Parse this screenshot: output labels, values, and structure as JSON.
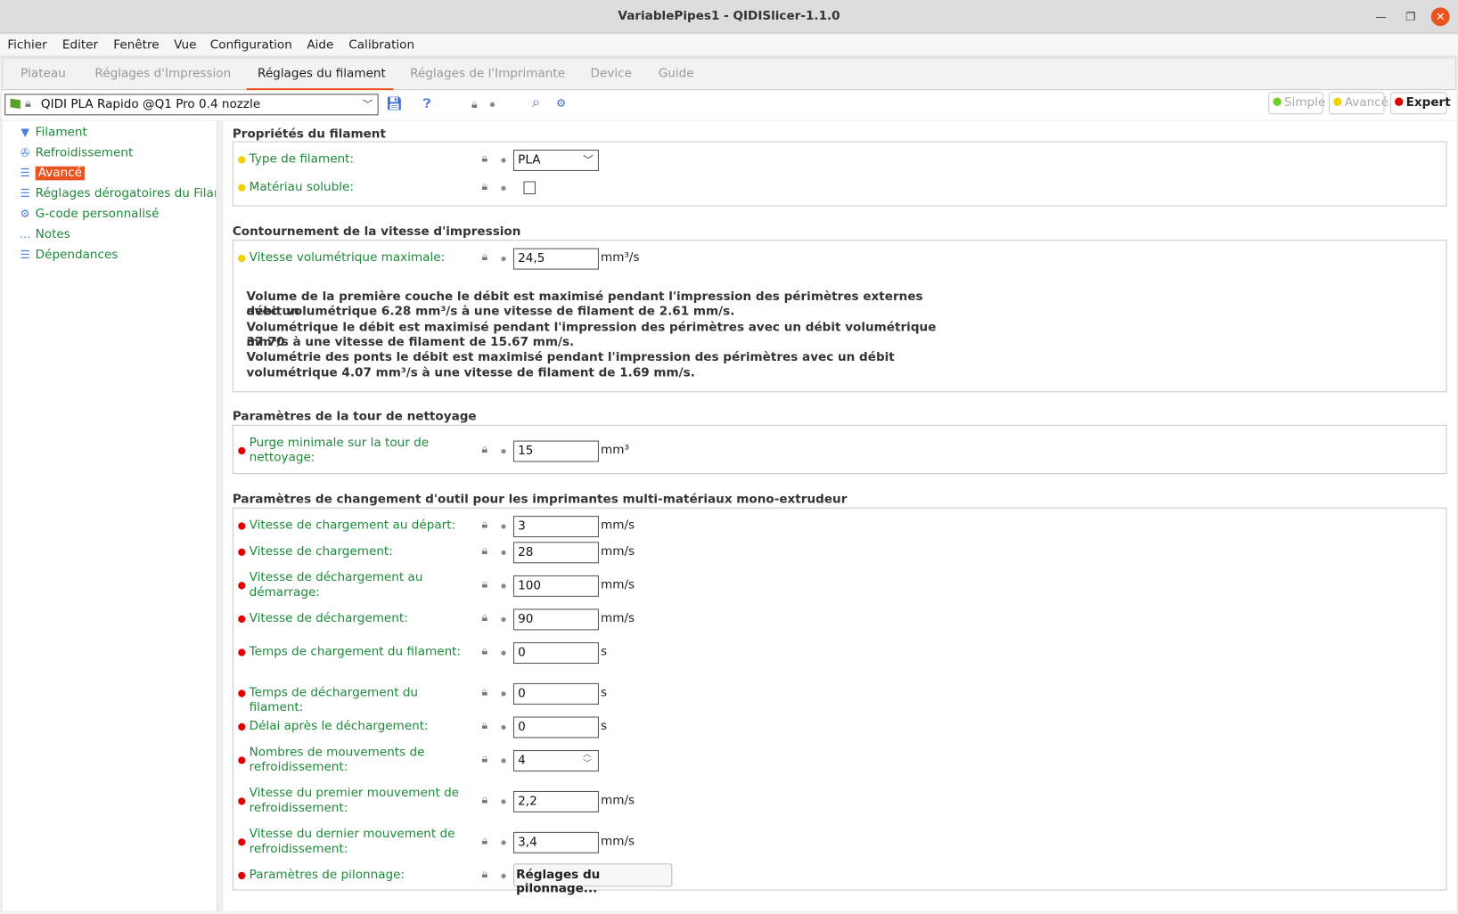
{
  "window": {
    "title": "VariablePipes1 - QIDISlicer-1.1.0"
  },
  "menu": [
    "Fichier",
    "Editer",
    "Fenêtre",
    "Vue",
    "Configuration",
    "Aide",
    "Calibration"
  ],
  "tabs": [
    "Plateau",
    "Réglages d'Impression",
    "Réglages du filament",
    "Réglages de l'Imprimante",
    "Device",
    "Guide"
  ],
  "active_tab": "Réglages du filament",
  "preset": {
    "name": "QIDI PLA Rapido @Q1 Pro 0.4 nozzle"
  },
  "modes": [
    {
      "label": "Simple",
      "color": "#6fd123"
    },
    {
      "label": "Avancé",
      "color": "#f0d000"
    },
    {
      "label": "Expert",
      "color": "#e00000"
    }
  ],
  "sidebar": [
    {
      "label": "Filament",
      "icon": "filament-icon"
    },
    {
      "label": "Refroidissement",
      "icon": "fan-icon"
    },
    {
      "label": "Avancé",
      "icon": "advanced-icon"
    },
    {
      "label": "Réglages dérogatoires du Filament",
      "icon": "overrides-icon"
    },
    {
      "label": "G-code personnalisé",
      "icon": "gear-icon"
    },
    {
      "label": "Notes",
      "icon": "notes-icon"
    },
    {
      "label": "Dépendances",
      "icon": "dependencies-icon"
    }
  ],
  "groups": [
    {
      "title": "Propriétés du filament"
    },
    {
      "title": "Contournement de la vitesse d'impression"
    },
    {
      "title": "Paramètres de la tour de nettoyage"
    },
    {
      "title": "Paramètres de changement d'outil pour les imprimantes multi-matériaux mono-extrudeur"
    }
  ],
  "colors": {
    "advanced": "#f0d000",
    "expert": "#e00000",
    "label": "#1d8a3a",
    "accent": "#e95420"
  },
  "rows": [
    {
      "label": "Type de filament:",
      "level": "advanced",
      "type": "select",
      "value": "PLA"
    },
    {
      "label": "Matériau soluble:",
      "level": "advanced",
      "type": "checkbox",
      "checked": false
    },
    {
      "label": "Vitesse volumétrique maximale:",
      "level": "advanced",
      "type": "input",
      "value": "24,5",
      "unit": "mm³/s"
    },
    {
      "label": "Purge minimale sur la tour de nettoyage:",
      "level": "expert",
      "type": "input",
      "value": "15",
      "unit": "mm³"
    },
    {
      "label": "Vitesse de chargement au départ:",
      "level": "expert",
      "type": "input",
      "value": "3",
      "unit": "mm/s"
    },
    {
      "label": "Vitesse de chargement:",
      "level": "expert",
      "type": "input",
      "value": "28",
      "unit": "mm/s"
    },
    {
      "label": "Vitesse de déchargement au démarrage:",
      "level": "expert",
      "type": "input",
      "value": "100",
      "unit": "mm/s"
    },
    {
      "label": "Vitesse de déchargement:",
      "level": "expert",
      "type": "input",
      "value": "90",
      "unit": "mm/s"
    },
    {
      "label": "Temps de chargement du filament:",
      "level": "expert",
      "type": "input",
      "value": "0",
      "unit": "s"
    },
    {
      "label": "Temps de déchargement du filament:",
      "level": "expert",
      "type": "input",
      "value": "0",
      "unit": "s"
    },
    {
      "label": "Délai après le déchargement:",
      "level": "expert",
      "type": "input",
      "value": "0",
      "unit": "s"
    },
    {
      "label": "Nombres de mouvements de refroidissement:",
      "level": "expert",
      "type": "spin",
      "value": "4"
    },
    {
      "label": "Vitesse du premier mouvement de refroidissement:",
      "level": "expert",
      "type": "input",
      "value": "2,2",
      "unit": "mm/s"
    },
    {
      "label": "Vitesse du dernier mouvement de refroidissement:",
      "level": "expert",
      "type": "input",
      "value": "3,4",
      "unit": "mm/s"
    },
    {
      "label": "Paramètres de pilonnage:",
      "level": "expert",
      "type": "button",
      "value": "Réglages du pilonnage..."
    }
  ],
  "info_lines": [
    "Volume de la première couche le débit est maximisé pendant l'impression des périmètres externes avec un",
    "débit volumétrique 6.28 mm³/s à une vitesse de filament de 2.61 mm/s.",
    "Volumétrique le débit est maximisé pendant l'impression des périmètres avec un débit volumétrique 37.70",
    "mm³/s à une vitesse de filament de 15.67 mm/s.",
    "Volumétrie des ponts le débit est maximisé pendant l'impression des périmètres avec un débit",
    "volumétrique 4.07 mm³/s à une vitesse de filament de 1.69 mm/s."
  ]
}
